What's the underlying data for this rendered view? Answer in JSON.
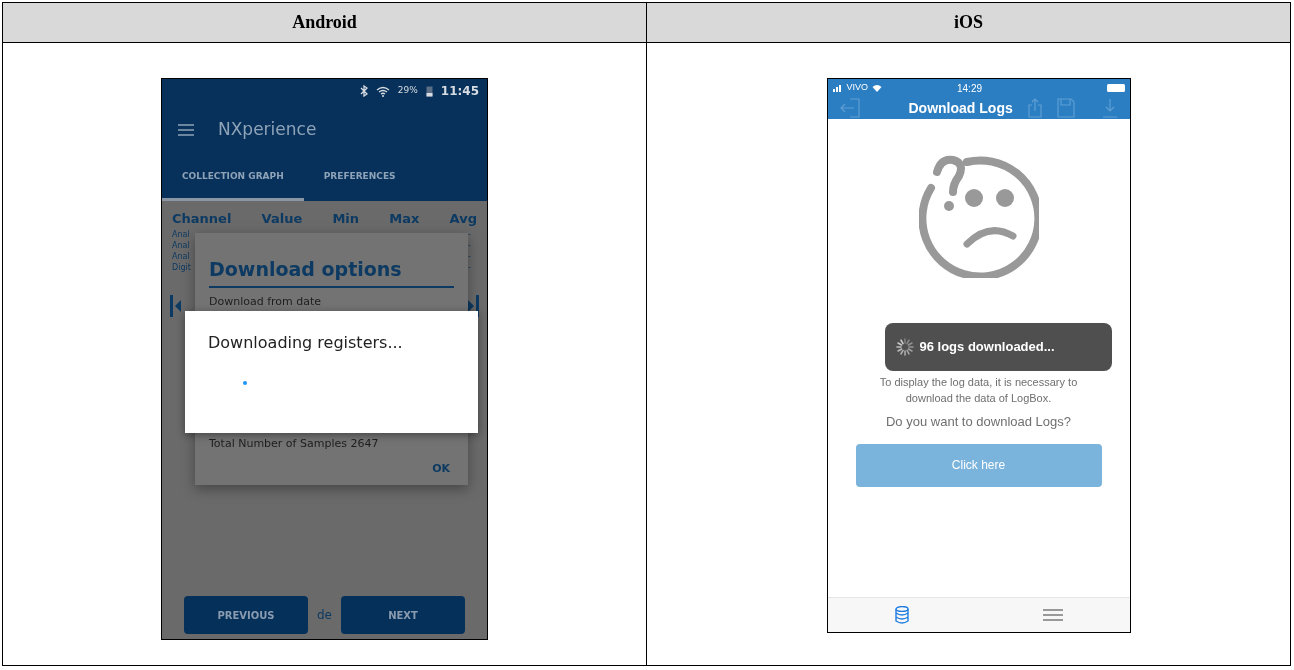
{
  "table": {
    "columns": [
      {
        "heading": "Android"
      },
      {
        "heading": "iOS"
      }
    ]
  },
  "android": {
    "status_bar": {
      "battery": "29%",
      "time": "11:45"
    },
    "app_bar": {
      "title": "NXperience"
    },
    "tabs": [
      {
        "label": "COLLECTION GRAPH",
        "selected": true
      },
      {
        "label": "PREFERENCES",
        "selected": false
      }
    ],
    "channel_table": {
      "columns": [
        "Channel",
        "Value",
        "Min",
        "Max",
        "Avg"
      ],
      "rows": [
        {
          "channel": "Anal",
          "avg": "-"
        },
        {
          "channel": "Anal",
          "avg": "-"
        },
        {
          "channel": "Anal",
          "avg": "-"
        },
        {
          "channel": "Digit",
          "avg": "-"
        }
      ]
    },
    "download_options_dialog": {
      "title": "Download options",
      "from_label": "Download from date",
      "samples_label": "Total Number of Samples  2647",
      "ok_button": "OK"
    },
    "progress_dialog": {
      "message": "Downloading registers..."
    },
    "pager": {
      "previous": "PREVIOUS",
      "separator": "de",
      "next": "NEXT"
    }
  },
  "ios": {
    "status_bar": {
      "carrier": "VIVO",
      "time": "14:29"
    },
    "nav_bar": {
      "title": "Download Logs"
    },
    "toast": {
      "message": "96 logs downloaded..."
    },
    "body": {
      "lines": [
        "To display the log data, it is necessary to",
        "download the data of LogBox."
      ],
      "question": "Do you want to download Logs?",
      "button": "Click here"
    },
    "tab_bar": [
      {
        "kind": "database",
        "selected": true
      },
      {
        "kind": "menu",
        "selected": false
      }
    ]
  }
}
